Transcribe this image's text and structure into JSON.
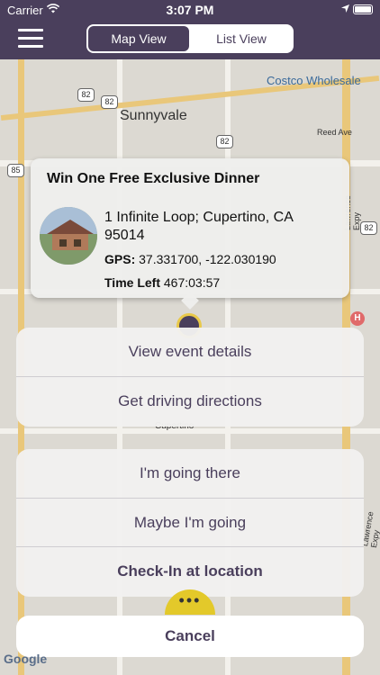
{
  "status_bar": {
    "carrier": "Carrier",
    "time": "3:07 PM"
  },
  "nav": {
    "tabs": [
      {
        "label": "Map View",
        "active": true
      },
      {
        "label": "List View",
        "active": false
      }
    ]
  },
  "map": {
    "labels": {
      "sunnyvale": "Sunnyvale",
      "costco": "Costco Wholesale",
      "lawrence_expy_1": "Lawrence Expy",
      "lawrence_expy_2": "Lawrence Expy",
      "reed_ave": "Reed Ave",
      "cupertino": "Cupertino"
    },
    "shields": {
      "s82a": "82",
      "s82b": "82",
      "s85": "85",
      "s82c": "82",
      "s82d": "82"
    },
    "poi": "H",
    "attribution": "Google"
  },
  "callout": {
    "title": "Win One Free Exclusive Dinner",
    "address": " 1 Infinite Loop; Cupertino, CA 95014",
    "gps_label": "GPS:",
    "gps_value": "37.331700, -122.030190",
    "time_label": "Time Left",
    "time_value": "467:03:57"
  },
  "action_sheet": {
    "group1": [
      "View event details",
      "Get driving directions"
    ],
    "group2": [
      "I'm going there",
      "Maybe I'm going",
      "Check-In at location"
    ],
    "cancel": "Cancel"
  },
  "fab_dots": "•••"
}
